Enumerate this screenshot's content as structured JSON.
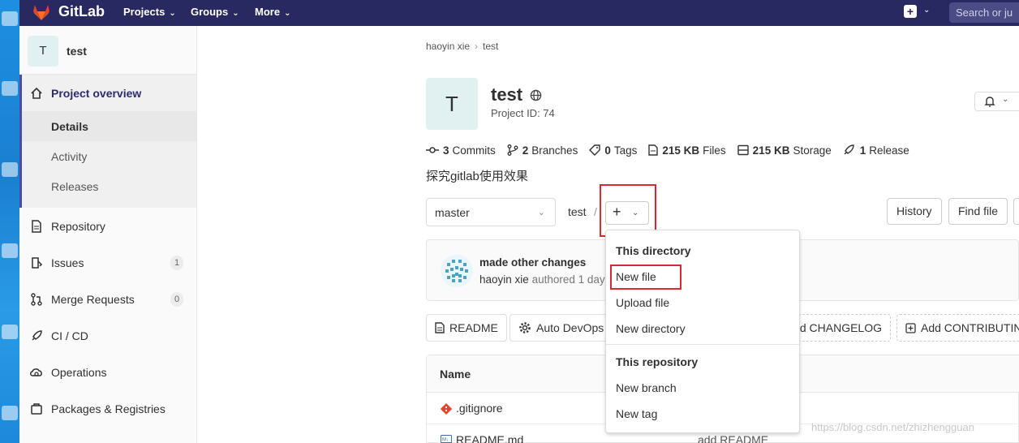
{
  "navbar": {
    "brand": "GitLab",
    "menus": [
      "Projects",
      "Groups",
      "More"
    ],
    "search_placeholder": "Search or ju"
  },
  "sidebar": {
    "project_initial": "T",
    "project_name": "test",
    "overview": {
      "label": "Project overview",
      "items": [
        "Details",
        "Activity",
        "Releases"
      ]
    },
    "items": [
      {
        "label": "Repository",
        "count": ""
      },
      {
        "label": "Issues",
        "count": "1"
      },
      {
        "label": "Merge Requests",
        "count": "0"
      },
      {
        "label": "CI / CD",
        "count": ""
      },
      {
        "label": "Operations",
        "count": ""
      },
      {
        "label": "Packages & Registries",
        "count": ""
      }
    ]
  },
  "breadcrumb": [
    "haoyin xie",
    "test"
  ],
  "project": {
    "initial": "T",
    "name": "test",
    "id_label": "Project ID: 74",
    "description": "探究gitlab使用效果"
  },
  "stats": [
    {
      "value": "3",
      "label": "Commits"
    },
    {
      "value": "2",
      "label": "Branches"
    },
    {
      "value": "0",
      "label": "Tags"
    },
    {
      "value": "215 KB",
      "label": "Files"
    },
    {
      "value": "215 KB",
      "label": "Storage"
    },
    {
      "value": "1",
      "label": "Release"
    }
  ],
  "toolbar": {
    "branch": "master",
    "path": "test",
    "path_sep": "/",
    "history": "History",
    "find_file": "Find file"
  },
  "commit": {
    "title": "made other changes",
    "author": "haoyin xie",
    "authored": "authored 1 day"
  },
  "pills": [
    "README",
    "Auto DevOps",
    "Add CHANGELOG",
    "Add CONTRIBUTING"
  ],
  "table": {
    "header": "Name",
    "rows": [
      {
        "name": ".gitignore",
        "message": ""
      },
      {
        "name": "README.md",
        "message": "add README"
      }
    ]
  },
  "dropdown": {
    "section1": "This directory",
    "items1": [
      "New file",
      "Upload file",
      "New directory"
    ],
    "section2": "This repository",
    "items2": [
      "New branch",
      "New tag"
    ]
  },
  "watermark": "https://blog.csdn.net/zhizhengguan",
  "colors": {
    "navbar": "#292961",
    "highlight": "#d9282e",
    "accent": "#4b4ba3"
  }
}
